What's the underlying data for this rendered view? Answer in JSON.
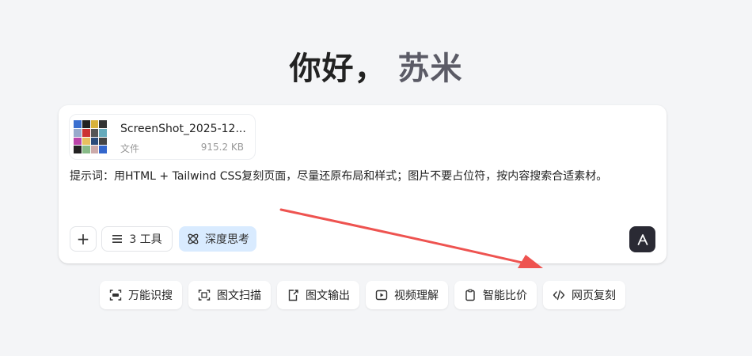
{
  "greeting": {
    "hello": "你好，",
    "name": "苏米"
  },
  "attachment": {
    "name": "ScreenShot_2025-12...",
    "type": "文件",
    "size": "915.2 KB"
  },
  "prompt": "提示词：用HTML + Tailwind CSS复刻页面，尽量还原布局和样式；图片不要占位符，按内容搜索合适素材。",
  "toolbar": {
    "tools_label": "3 工具",
    "deep_think_label": "深度思考"
  },
  "quick_actions": [
    {
      "label": "万能识搜",
      "icon": "ai-scan-icon"
    },
    {
      "label": "图文扫描",
      "icon": "doc-scan-icon"
    },
    {
      "label": "图文输出",
      "icon": "export-icon"
    },
    {
      "label": "视频理解",
      "icon": "video-icon"
    },
    {
      "label": "智能比价",
      "icon": "clipboard-icon"
    },
    {
      "label": "网页复刻",
      "icon": "code-icon"
    }
  ],
  "colors": {
    "background": "#f4f5f7",
    "deep_think_bg": "#d9ebff",
    "send_button": "#2a2a34",
    "annotation_arrow": "#ee5350"
  }
}
